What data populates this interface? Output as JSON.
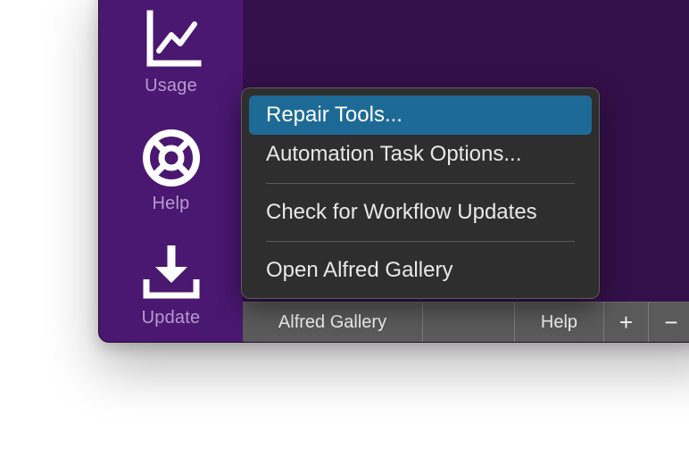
{
  "sidebar": {
    "items": [
      {
        "label": "Usage",
        "icon": "chart-line-icon"
      },
      {
        "label": "Help",
        "icon": "lifebuoy-icon"
      },
      {
        "label": "Update",
        "icon": "download-icon"
      }
    ]
  },
  "context_menu": {
    "items": [
      {
        "label": "Repair Tools...",
        "highlighted": true
      },
      {
        "label": "Automation Task Options...",
        "highlighted": false
      },
      {
        "label": "Check for Workflow Updates",
        "highlighted": false
      },
      {
        "label": "Open Alfred Gallery",
        "highlighted": false
      }
    ]
  },
  "bottom_bar": {
    "gallery_label": "Alfred Gallery",
    "help_label": "Help",
    "add_label": "+",
    "remove_label": "−"
  },
  "colors": {
    "sidebar_bg": "#4a1771",
    "content_bg": "#34104a",
    "menu_bg": "#2e2e2e",
    "menu_highlight": "#1e6a96",
    "bar_bg": "#5a5a5a"
  }
}
